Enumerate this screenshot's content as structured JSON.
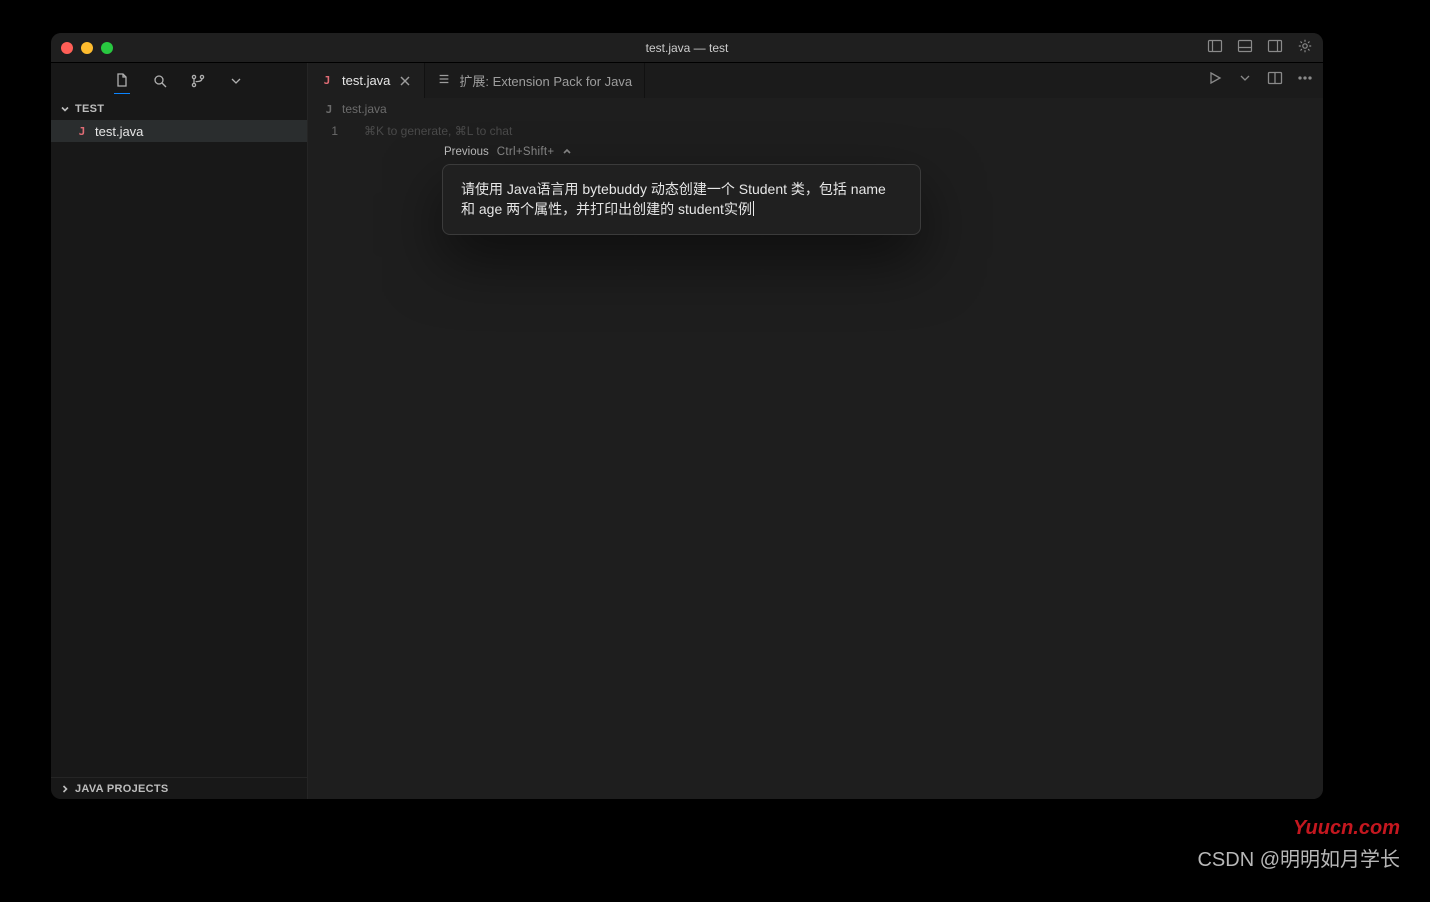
{
  "window": {
    "title": "test.java — test"
  },
  "titlebar_icons": [
    "panel-left",
    "panel-bottom",
    "panel-right",
    "gear"
  ],
  "sidebar": {
    "toolbar_icons": [
      "files",
      "search",
      "branch",
      "chevron-down"
    ],
    "section_label": "TEST",
    "file": {
      "badge": "J",
      "name": "test.java"
    },
    "bottom_section_label": "JAVA PROJECTS"
  },
  "tabs": [
    {
      "badge": "J",
      "label": "test.java",
      "active": true,
      "closable": true
    },
    {
      "icon": "list",
      "label": "扩展: Extension Pack for Java",
      "active": false,
      "closable": false
    }
  ],
  "editor_actions": [
    "run",
    "split",
    "layout",
    "more"
  ],
  "breadcrumb": {
    "badge": "J",
    "label": "test.java"
  },
  "editor": {
    "line_number": "1",
    "hint_text": "⌘K to generate, ⌘L to chat",
    "prev_label": "Previous",
    "prev_shortcut": "Ctrl+Shift+",
    "ai_prompt": "请使用 Java语言用 bytebuddy 动态创建一个 Student 类，包括 name 和 age 两个属性，并打印出创建的 student实例"
  },
  "watermarks": {
    "site": "Yuucn.com",
    "credit": "CSDN @明明如月学长"
  }
}
